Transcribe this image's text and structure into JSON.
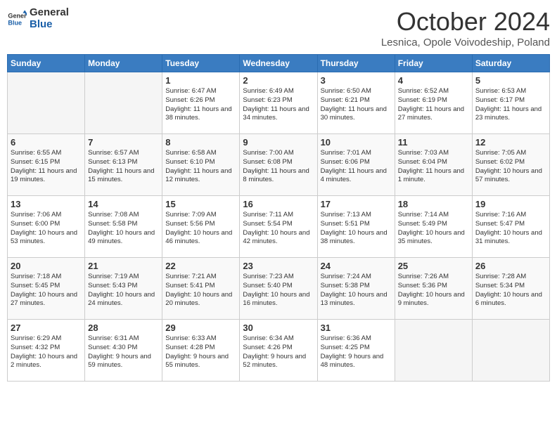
{
  "header": {
    "logo_line1": "General",
    "logo_line2": "Blue",
    "month_title": "October 2024",
    "location": "Lesnica, Opole Voivodeship, Poland"
  },
  "weekdays": [
    "Sunday",
    "Monday",
    "Tuesday",
    "Wednesday",
    "Thursday",
    "Friday",
    "Saturday"
  ],
  "weeks": [
    [
      {
        "day": "",
        "text": "",
        "empty": true
      },
      {
        "day": "",
        "text": "",
        "empty": true
      },
      {
        "day": "1",
        "text": "Sunrise: 6:47 AM\nSunset: 6:26 PM\nDaylight: 11 hours and 38 minutes.",
        "empty": false
      },
      {
        "day": "2",
        "text": "Sunrise: 6:49 AM\nSunset: 6:23 PM\nDaylight: 11 hours and 34 minutes.",
        "empty": false
      },
      {
        "day": "3",
        "text": "Sunrise: 6:50 AM\nSunset: 6:21 PM\nDaylight: 11 hours and 30 minutes.",
        "empty": false
      },
      {
        "day": "4",
        "text": "Sunrise: 6:52 AM\nSunset: 6:19 PM\nDaylight: 11 hours and 27 minutes.",
        "empty": false
      },
      {
        "day": "5",
        "text": "Sunrise: 6:53 AM\nSunset: 6:17 PM\nDaylight: 11 hours and 23 minutes.",
        "empty": false
      }
    ],
    [
      {
        "day": "6",
        "text": "Sunrise: 6:55 AM\nSunset: 6:15 PM\nDaylight: 11 hours and 19 minutes.",
        "empty": false
      },
      {
        "day": "7",
        "text": "Sunrise: 6:57 AM\nSunset: 6:13 PM\nDaylight: 11 hours and 15 minutes.",
        "empty": false
      },
      {
        "day": "8",
        "text": "Sunrise: 6:58 AM\nSunset: 6:10 PM\nDaylight: 11 hours and 12 minutes.",
        "empty": false
      },
      {
        "day": "9",
        "text": "Sunrise: 7:00 AM\nSunset: 6:08 PM\nDaylight: 11 hours and 8 minutes.",
        "empty": false
      },
      {
        "day": "10",
        "text": "Sunrise: 7:01 AM\nSunset: 6:06 PM\nDaylight: 11 hours and 4 minutes.",
        "empty": false
      },
      {
        "day": "11",
        "text": "Sunrise: 7:03 AM\nSunset: 6:04 PM\nDaylight: 11 hours and 1 minute.",
        "empty": false
      },
      {
        "day": "12",
        "text": "Sunrise: 7:05 AM\nSunset: 6:02 PM\nDaylight: 10 hours and 57 minutes.",
        "empty": false
      }
    ],
    [
      {
        "day": "13",
        "text": "Sunrise: 7:06 AM\nSunset: 6:00 PM\nDaylight: 10 hours and 53 minutes.",
        "empty": false
      },
      {
        "day": "14",
        "text": "Sunrise: 7:08 AM\nSunset: 5:58 PM\nDaylight: 10 hours and 49 minutes.",
        "empty": false
      },
      {
        "day": "15",
        "text": "Sunrise: 7:09 AM\nSunset: 5:56 PM\nDaylight: 10 hours and 46 minutes.",
        "empty": false
      },
      {
        "day": "16",
        "text": "Sunrise: 7:11 AM\nSunset: 5:54 PM\nDaylight: 10 hours and 42 minutes.",
        "empty": false
      },
      {
        "day": "17",
        "text": "Sunrise: 7:13 AM\nSunset: 5:51 PM\nDaylight: 10 hours and 38 minutes.",
        "empty": false
      },
      {
        "day": "18",
        "text": "Sunrise: 7:14 AM\nSunset: 5:49 PM\nDaylight: 10 hours and 35 minutes.",
        "empty": false
      },
      {
        "day": "19",
        "text": "Sunrise: 7:16 AM\nSunset: 5:47 PM\nDaylight: 10 hours and 31 minutes.",
        "empty": false
      }
    ],
    [
      {
        "day": "20",
        "text": "Sunrise: 7:18 AM\nSunset: 5:45 PM\nDaylight: 10 hours and 27 minutes.",
        "empty": false
      },
      {
        "day": "21",
        "text": "Sunrise: 7:19 AM\nSunset: 5:43 PM\nDaylight: 10 hours and 24 minutes.",
        "empty": false
      },
      {
        "day": "22",
        "text": "Sunrise: 7:21 AM\nSunset: 5:41 PM\nDaylight: 10 hours and 20 minutes.",
        "empty": false
      },
      {
        "day": "23",
        "text": "Sunrise: 7:23 AM\nSunset: 5:40 PM\nDaylight: 10 hours and 16 minutes.",
        "empty": false
      },
      {
        "day": "24",
        "text": "Sunrise: 7:24 AM\nSunset: 5:38 PM\nDaylight: 10 hours and 13 minutes.",
        "empty": false
      },
      {
        "day": "25",
        "text": "Sunrise: 7:26 AM\nSunset: 5:36 PM\nDaylight: 10 hours and 9 minutes.",
        "empty": false
      },
      {
        "day": "26",
        "text": "Sunrise: 7:28 AM\nSunset: 5:34 PM\nDaylight: 10 hours and 6 minutes.",
        "empty": false
      }
    ],
    [
      {
        "day": "27",
        "text": "Sunrise: 6:29 AM\nSunset: 4:32 PM\nDaylight: 10 hours and 2 minutes.",
        "empty": false
      },
      {
        "day": "28",
        "text": "Sunrise: 6:31 AM\nSunset: 4:30 PM\nDaylight: 9 hours and 59 minutes.",
        "empty": false
      },
      {
        "day": "29",
        "text": "Sunrise: 6:33 AM\nSunset: 4:28 PM\nDaylight: 9 hours and 55 minutes.",
        "empty": false
      },
      {
        "day": "30",
        "text": "Sunrise: 6:34 AM\nSunset: 4:26 PM\nDaylight: 9 hours and 52 minutes.",
        "empty": false
      },
      {
        "day": "31",
        "text": "Sunrise: 6:36 AM\nSunset: 4:25 PM\nDaylight: 9 hours and 48 minutes.",
        "empty": false
      },
      {
        "day": "",
        "text": "",
        "empty": true
      },
      {
        "day": "",
        "text": "",
        "empty": true
      }
    ]
  ]
}
